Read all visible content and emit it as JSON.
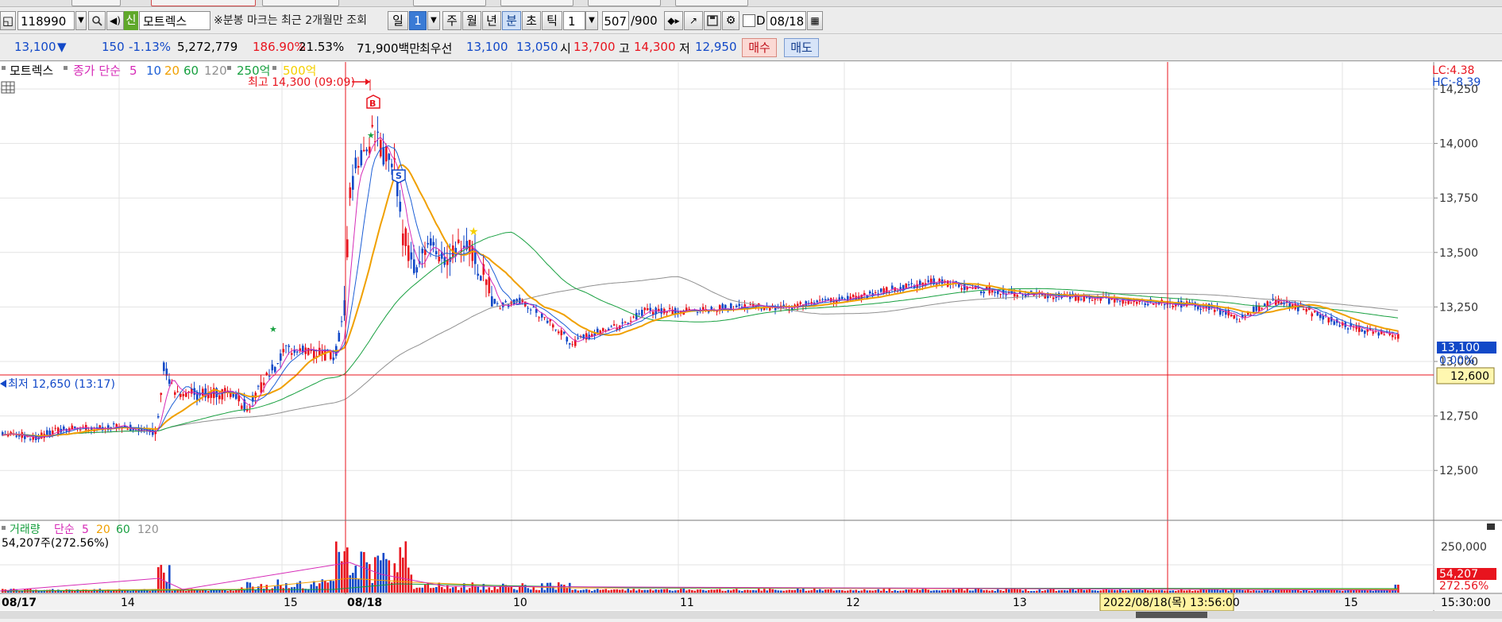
{
  "toolbar": {
    "stock_code": "118990",
    "stock_badge": "신",
    "stock_name": "모트렉스",
    "notice": "※분봉 마크는 최근 2개월만 조회",
    "period_day": "일",
    "period_value": "1",
    "period_week": "주",
    "period_month": "월",
    "period_year": "년",
    "period_min": "분",
    "period_sec": "초",
    "period_tick": "틱",
    "interval": "1",
    "count": "507",
    "count_total": "/900",
    "date_check_label": "D",
    "date": "08/18"
  },
  "quote": {
    "price": "13,100",
    "arrow": "▼",
    "change": "150",
    "change_pct": "-1.13%",
    "volume": "5,272,779",
    "vol_ratio": "186.90%",
    "turnover": "21.53%",
    "amount": "71,900백만",
    "best_label": "최우선",
    "best_ask": "13,100",
    "best_bid": "13,050",
    "open_label": "시",
    "open": "13,700",
    "high_label": "고",
    "high": "14,300",
    "low_label": "저",
    "low": "12,950",
    "buy_button": "매수",
    "sell_button": "매도"
  },
  "legend": {
    "stock_name": "모트렉스",
    "ma_label": "종가 단순",
    "ma5": "5",
    "ma10": "10",
    "ma20": "20",
    "ma60": "60",
    "ma120": "120",
    "amt1": "250억",
    "amt2": "500억"
  },
  "annotations": {
    "high_marker": "최고 14,300 (09:09)",
    "low_marker": "최저 12,650 (13:17)",
    "lc": "LC:4.38",
    "hc": "HC:-8.39",
    "buy_mark": "B",
    "sell_mark": "S"
  },
  "price_axis": {
    "ticks": [
      "14,250",
      "14,000",
      "13,750",
      "13,500",
      "13,250",
      "13,000",
      "12,750",
      "12,500"
    ],
    "current_price": "13,100",
    "current_pct": "0.00%",
    "crosshair_price": "12,600"
  },
  "volume_panel": {
    "label": "거래량",
    "ma_label": "단순",
    "ma5": "5",
    "ma20": "20",
    "ma60": "60",
    "ma120": "120",
    "current": "54,207주(272.56%)",
    "axis_tick": "250,000",
    "current_badge": "54,207",
    "current_pct": "272.56%"
  },
  "time_axis": {
    "labels": [
      "08/17",
      "14",
      "15",
      "08/18",
      "10",
      "11",
      "12",
      "13",
      "15"
    ],
    "crosshair_time": "2022/08/18(목) 13:56:00",
    "end_time": "15:30:00"
  },
  "colors": {
    "up": "#e8141e",
    "down": "#1249c8",
    "ma5": "#d62bb7",
    "ma10": "#1d5fd6",
    "ma20": "#f0a000",
    "ma60": "#18a040",
    "ma120": "#909090",
    "crosshair": "#e8141e"
  }
}
